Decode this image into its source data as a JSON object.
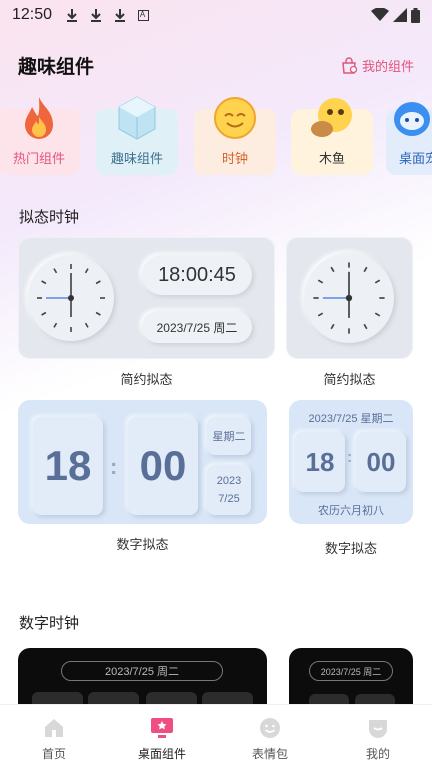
{
  "status": {
    "time": "12:50",
    "download_icons": [
      "download-icon",
      "download-icon",
      "download-icon"
    ],
    "app_badge": "A"
  },
  "header": {
    "title": "趣味组件",
    "my_widgets": "我的组件"
  },
  "categories": [
    {
      "label": "热门组件",
      "icon": "fire-icon",
      "color": "#e2557e",
      "bg": "#fde4ea"
    },
    {
      "label": "趣味组件",
      "icon": "cube-icon",
      "color": "#3d6f8c",
      "bg": "#dff1f7"
    },
    {
      "label": "时钟",
      "icon": "emoji-clock-icon",
      "color": "#d5632d",
      "bg": "#fdece0"
    },
    {
      "label": "木鱼",
      "icon": "emoji-woodfish-icon",
      "color": "#333333",
      "bg": "#fff3dd"
    },
    {
      "label": "桌面宠",
      "icon": "robot-icon",
      "color": "#2c66b8",
      "bg": "#e3ecfb"
    }
  ],
  "sections": {
    "neu_clock": "拟态时钟",
    "digital_clock": "数字时钟"
  },
  "widgets": {
    "w1": {
      "time": "18:00:45",
      "date": "2023/7/25 周二",
      "caption": "简约拟态"
    },
    "w2": {
      "caption": "简约拟态"
    },
    "w3": {
      "hour": "18",
      "minute": "00",
      "weekday": "星期二",
      "year": "2023",
      "monthday": "7/25",
      "caption": "数字拟态"
    },
    "w4": {
      "date": "2023/7/25 星期二",
      "hour": "18",
      "minute": "00",
      "lunar": "农历六月初八",
      "caption": "数字拟态"
    },
    "d1": {
      "date": "2023/7/25  周二"
    },
    "d2": {
      "date": "2023/7/25  周二"
    }
  },
  "tabs": [
    {
      "label": "首页",
      "icon": "home-icon",
      "active": false
    },
    {
      "label": "桌面组件",
      "icon": "desktop-widget-icon",
      "active": true
    },
    {
      "label": "表情包",
      "icon": "smiley-icon",
      "active": false
    },
    {
      "label": "我的",
      "icon": "profile-icon",
      "active": false
    }
  ],
  "colors": {
    "accent": "#e2557e",
    "tile_text": "#5a6f98"
  }
}
